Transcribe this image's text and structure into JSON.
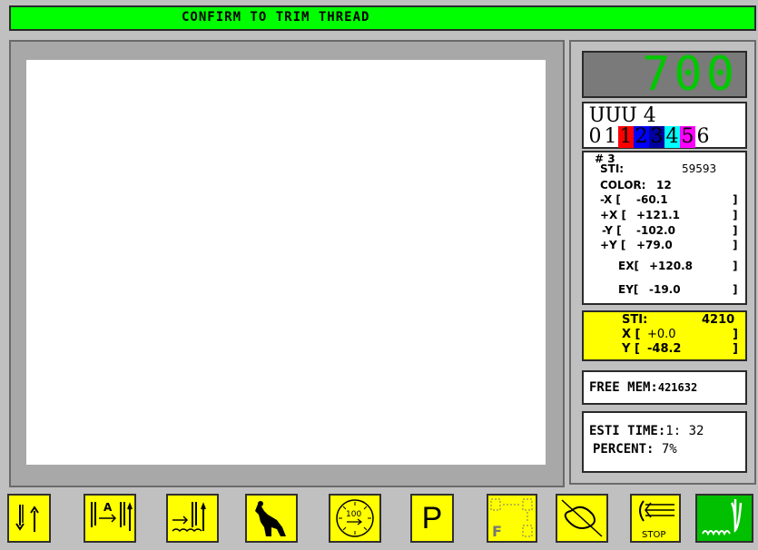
{
  "header": {
    "message": "CONFIRM TO TRIM THREAD"
  },
  "speed_display": {
    "value": "700"
  },
  "needle_panel": {
    "active_count": "4",
    "digits": [
      "0",
      "1",
      "1",
      "2",
      "3",
      "4",
      "5",
      "6"
    ]
  },
  "stats": {
    "label_num": "# 3",
    "sti_label": "STI:",
    "sti_value": "59593",
    "color_label": "COLOR:",
    "color_value": "12",
    "neg_x_label": "-X [",
    "neg_x_value": "-60.1",
    "pos_x_label": "+X [",
    "pos_x_value": "+121.1",
    "neg_y_label": "-Y [",
    "neg_y_value": "-102.0",
    "pos_y_label": "+Y [",
    "pos_y_value": "+79.0",
    "ex_label": "EX[",
    "ex_value": "+120.8",
    "ey_label": "EY[",
    "ey_value": "-19.0",
    "bracket": "]"
  },
  "current_position": {
    "sti_label": "STI:",
    "sti_value": "4210",
    "x_label": "X [",
    "x_value": "+0.0",
    "y_label": "Y [",
    "y_value": "-48.2",
    "bracket": "]"
  },
  "memory": {
    "label": "FREE MEM:",
    "value": "421632"
  },
  "progress": {
    "time_label": "ESTI TIME:",
    "time_value": "1: 32",
    "percent_label": "PERCENT:",
    "percent_value": "7%"
  },
  "toolbar": {
    "buttons": [
      {
        "icon": "needle-up-down-icon"
      },
      {
        "icon": "auto-needle-icon"
      },
      {
        "icon": "stitch-feed-icon"
      },
      {
        "icon": "kangaroo-icon"
      },
      {
        "icon": "speed-dial-icon",
        "label": "100"
      },
      {
        "icon": "p-letter-icon",
        "label": "P"
      },
      {
        "icon": "frame-move-icon",
        "label": "F"
      },
      {
        "icon": "loop-icon"
      },
      {
        "icon": "stop-icon",
        "label": "STOP"
      },
      {
        "icon": "sew-start-icon"
      }
    ]
  },
  "colors": {
    "green": "#00ff00",
    "yellow": "#ffff00",
    "dark_green": "#008000"
  }
}
